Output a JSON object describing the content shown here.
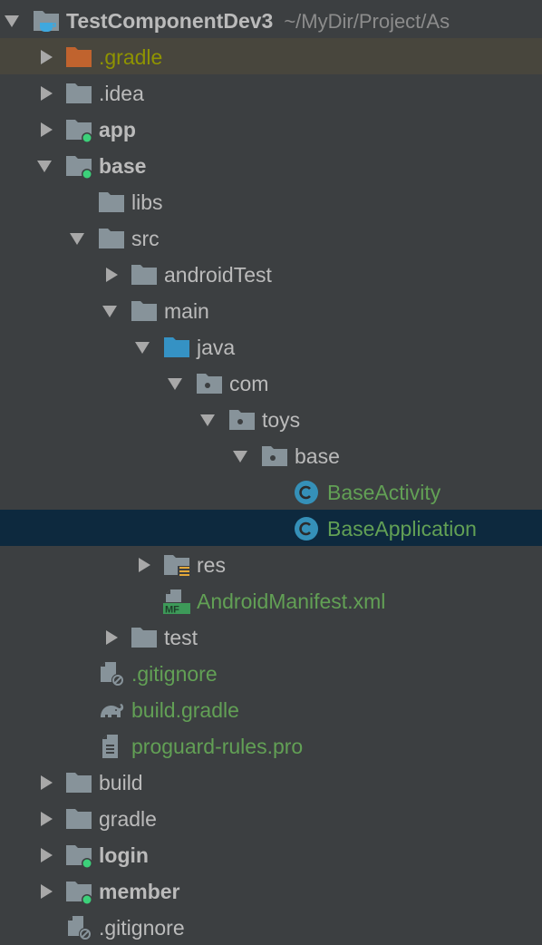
{
  "colors": {
    "background": "#3c3f41",
    "selected": "#0d293e",
    "highlight": "#48463d",
    "text": "#bbbbbb",
    "vcs_added": "#62a055",
    "ignored": "#8f9400",
    "folder": "#87939a",
    "source_folder": "#3592c4",
    "excluded_folder": "#c0632e",
    "module_dot": "#3cd17a"
  },
  "tree": [
    {
      "label": "TestComponentDev3",
      "path": "~/MyDir/Project/As",
      "level": 0,
      "arrow": "open",
      "icon": "project-folder",
      "bold": true
    },
    {
      "label": ".gradle",
      "level": 1,
      "arrow": "closed",
      "icon": "excluded-folder",
      "color": "olive",
      "state": "hl"
    },
    {
      "label": ".idea",
      "level": 1,
      "arrow": "closed",
      "icon": "folder"
    },
    {
      "label": "app",
      "level": 1,
      "arrow": "closed",
      "icon": "module-folder",
      "bold": true
    },
    {
      "label": "base",
      "level": 1,
      "arrow": "open",
      "icon": "module-folder",
      "bold": true
    },
    {
      "label": "libs",
      "level": 2,
      "arrow": "none",
      "icon": "folder"
    },
    {
      "label": "src",
      "level": 2,
      "arrow": "open",
      "icon": "folder"
    },
    {
      "label": "androidTest",
      "level": 3,
      "arrow": "closed",
      "icon": "folder"
    },
    {
      "label": "main",
      "level": 3,
      "arrow": "open",
      "icon": "folder"
    },
    {
      "label": "java",
      "level": 4,
      "arrow": "open",
      "icon": "source-folder"
    },
    {
      "label": "com",
      "level": 5,
      "arrow": "open",
      "icon": "package"
    },
    {
      "label": "toys",
      "level": 6,
      "arrow": "open",
      "icon": "package"
    },
    {
      "label": "base",
      "level": 7,
      "arrow": "open",
      "icon": "package"
    },
    {
      "label": "BaseActivity",
      "level": 8,
      "arrow": "none",
      "icon": "class",
      "color": "green"
    },
    {
      "label": "BaseApplication",
      "level": 8,
      "arrow": "none",
      "icon": "class",
      "color": "green",
      "state": "sel"
    },
    {
      "label": "res",
      "level": 4,
      "arrow": "closed",
      "icon": "resource-folder"
    },
    {
      "label": "AndroidManifest.xml",
      "level": 4,
      "arrow": "none",
      "icon": "manifest",
      "color": "green",
      "icon_text": "MF"
    },
    {
      "label": "test",
      "level": 3,
      "arrow": "closed",
      "icon": "folder"
    },
    {
      "label": ".gitignore",
      "level": 2,
      "arrow": "none",
      "icon": "ignore-file",
      "color": "green"
    },
    {
      "label": "build.gradle",
      "level": 2,
      "arrow": "none",
      "icon": "gradle",
      "color": "green"
    },
    {
      "label": "proguard-rules.pro",
      "level": 2,
      "arrow": "none",
      "icon": "text-file",
      "color": "green"
    },
    {
      "label": "build",
      "level": 1,
      "arrow": "closed",
      "icon": "folder"
    },
    {
      "label": "gradle",
      "level": 1,
      "arrow": "closed",
      "icon": "folder"
    },
    {
      "label": "login",
      "level": 1,
      "arrow": "closed",
      "icon": "module-folder",
      "bold": true
    },
    {
      "label": "member",
      "level": 1,
      "arrow": "closed",
      "icon": "module-folder",
      "bold": true
    },
    {
      "label": ".gitignore",
      "level": 1,
      "arrow": "none",
      "icon": "ignore-file"
    }
  ]
}
